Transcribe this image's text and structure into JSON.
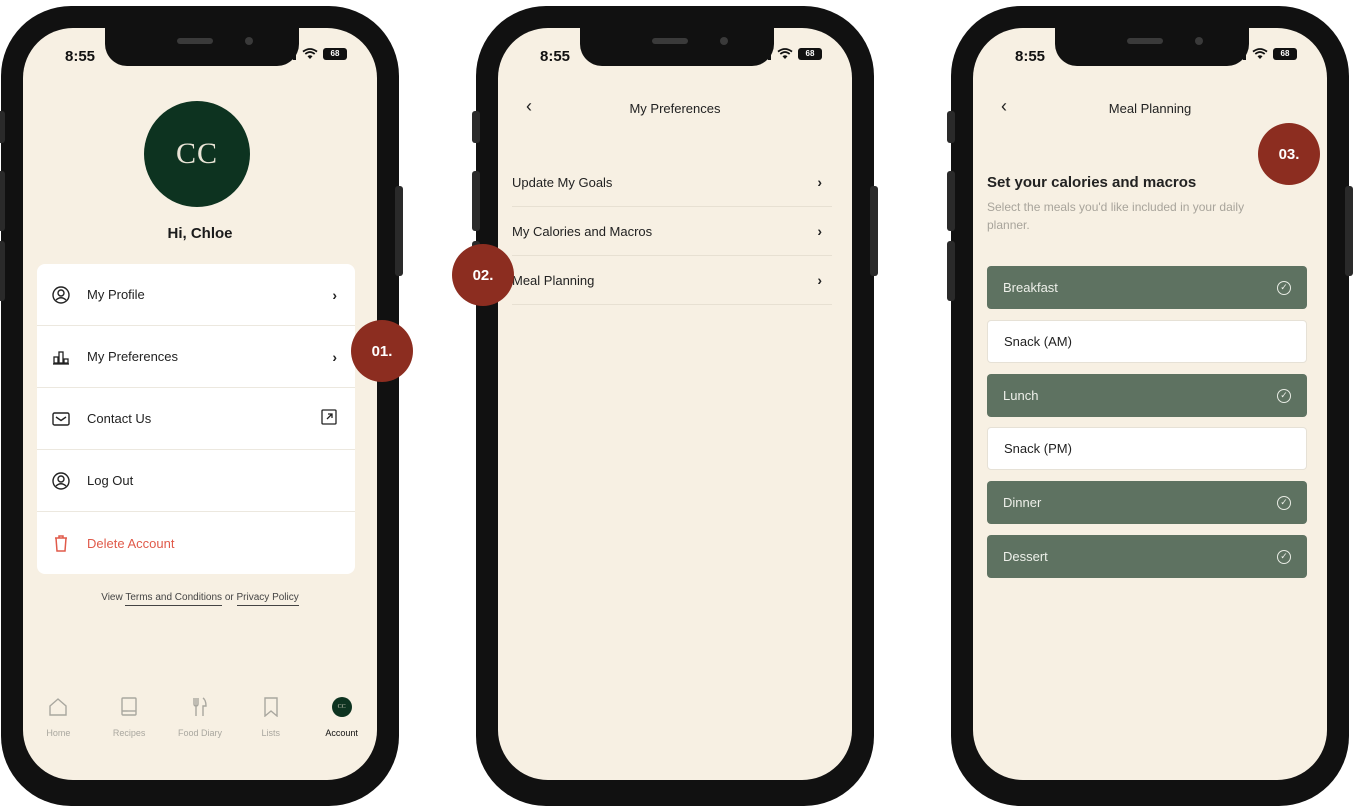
{
  "status_bar": {
    "time": "8:55",
    "battery": "68"
  },
  "screen1": {
    "avatar_initials": "CC",
    "greeting": "Hi, Chloe",
    "menu": [
      {
        "label": "My Profile",
        "icon": "user-circle-icon",
        "trailing": "chevron"
      },
      {
        "label": "My Preferences",
        "icon": "preferences-icon",
        "trailing": "chevron"
      },
      {
        "label": "Contact Us",
        "icon": "envelope-icon",
        "trailing": "external"
      },
      {
        "label": "Log Out",
        "icon": "user-circle-icon",
        "trailing": ""
      },
      {
        "label": "Delete Account",
        "icon": "trash-icon",
        "trailing": ""
      }
    ],
    "legal": {
      "prefix": "View",
      "terms": "Terms and Conditions",
      "joiner": "or",
      "privacy": "Privacy Policy"
    },
    "tabs": [
      {
        "label": "Home",
        "icon": "home-icon"
      },
      {
        "label": "Recipes",
        "icon": "book-icon"
      },
      {
        "label": "Food Diary",
        "icon": "cutlery-icon"
      },
      {
        "label": "Lists",
        "icon": "bookmark-icon"
      },
      {
        "label": "Account",
        "icon": "account-avatar-icon",
        "avatar": "CC"
      }
    ]
  },
  "screen2": {
    "title": "My Preferences",
    "items": [
      {
        "label": "Update My Goals"
      },
      {
        "label": "My Calories and Macros"
      },
      {
        "label": "Meal Planning"
      }
    ]
  },
  "screen3": {
    "title": "Meal Planning",
    "heading": "Set your calories and macros",
    "description": "Select the meals you'd like included in your daily planner.",
    "meals": [
      {
        "label": "Breakfast",
        "selected": true
      },
      {
        "label": "Snack (AM)",
        "selected": false
      },
      {
        "label": "Lunch",
        "selected": true
      },
      {
        "label": "Snack (PM)",
        "selected": false
      },
      {
        "label": "Dinner",
        "selected": true
      },
      {
        "label": "Dessert",
        "selected": true
      }
    ]
  },
  "badges": [
    "01.",
    "02.",
    "03."
  ],
  "colors": {
    "brand_green": "#0d3320",
    "selected_meal": "#5e7261",
    "badge": "#8c2d20",
    "screen_bg": "#f7f0e3",
    "danger": "#e05a4a"
  }
}
